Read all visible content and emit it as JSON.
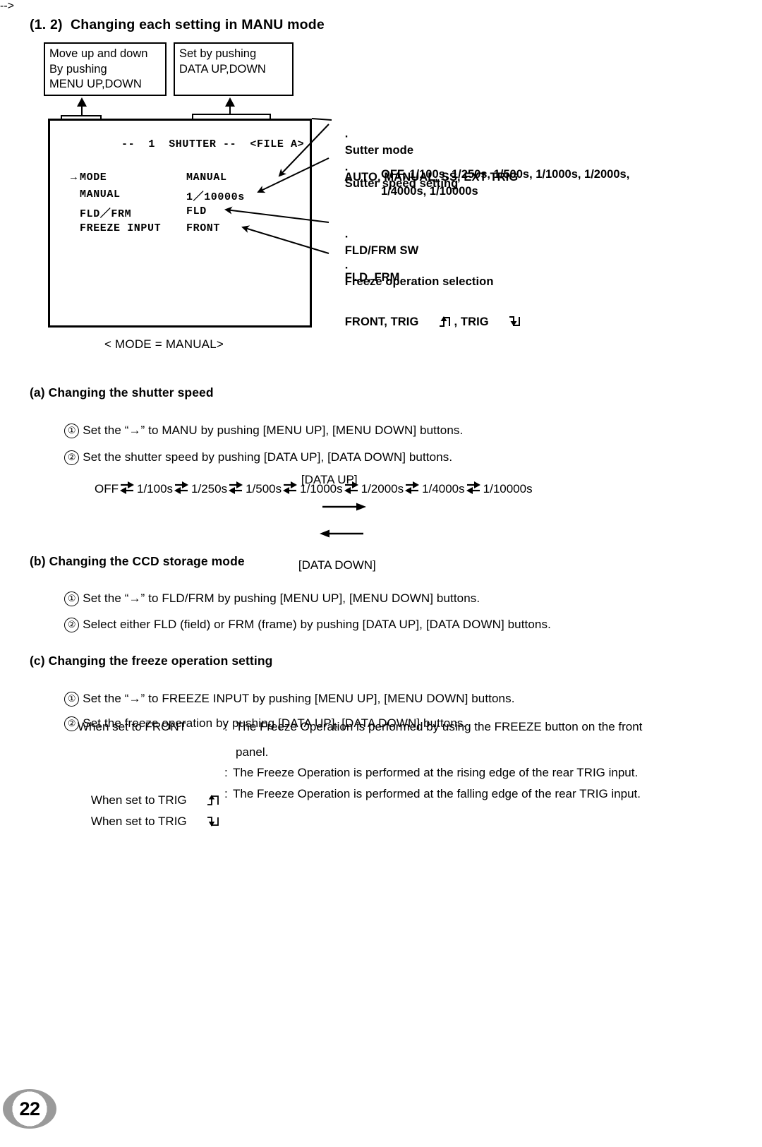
{
  "document": {
    "page_number": "22",
    "section_title": "(1. 2)  Changing each setting in MANU mode"
  },
  "diagram": {
    "callouts": [
      {
        "id": "menu",
        "text": "Move up and down\nBy pushing\nMENU UP,DOWN"
      },
      {
        "id": "data",
        "text": "Set by pushing\nDATA UP,DOWN"
      }
    ],
    "display": {
      "header": "--  1  SHUTTER --  <FILE A>",
      "rows": [
        {
          "pointer": "→",
          "label": "MODE",
          "value": "MANUAL"
        },
        {
          "pointer": " ",
          "label": "MANUAL",
          "value": "1／10000s"
        },
        {
          "pointer": " ",
          "label": "FLD／FRM",
          "value": "FLD"
        },
        {
          "pointer": " ",
          "label": "FREEZE INPUT",
          "value": "FRONT"
        }
      ],
      "caption": "< MODE = MANUAL>"
    },
    "annotations": [
      {
        "bullet": "·",
        "title": "Sutter mode",
        "values": "AUTO, MANUAL, SS, EXT TRIG"
      },
      {
        "bullet": "·",
        "title": "Sutter speed setting",
        "values": ""
      },
      {
        "bullet": "·",
        "title": "FLD/FRM SW",
        "values": "FLD, FRM"
      },
      {
        "bullet": "·",
        "title": "Freeze operation selection",
        "values": "FRONT, TRIG"
      }
    ],
    "speed_list_line1": "OFF, 1/100s, 1/250s, 1/500s, 1/1000s, 1/2000s,",
    "speed_list_line2": "1/4000s, 1/10000s",
    "freeze_values_tail": ", TRIG"
  },
  "section_a": {
    "heading": "(a) Changing the shutter speed",
    "steps": [
      {
        "num": "①",
        "text": "Set the “→” to MANU by pushing [MENU UP], [MENU DOWN] buttons."
      },
      {
        "num": "②",
        "text": "Set the shutter speed by pushing [DATA UP], [DATA DOWN] buttons."
      }
    ],
    "chain": {
      "up_label": "[DATA UP]",
      "down_label": "[DATA DOWN]",
      "items": [
        "OFF",
        "1/100s",
        "1/250s",
        "1/500s",
        "1/1000s",
        "1/2000s",
        "1/4000s",
        "1/10000s"
      ]
    }
  },
  "section_b": {
    "heading": "(b) Changing the CCD storage mode",
    "steps": [
      {
        "num": "①",
        "text": "Set the “→” to FLD/FRM by pushing [MENU UP], [MENU DOWN] buttons."
      },
      {
        "num": "②",
        "text": "Select either FLD (field) or FRM (frame) by pushing [DATA UP], [DATA DOWN] buttons."
      }
    ]
  },
  "section_c": {
    "heading": "(c) Changing the freeze operation setting",
    "steps": [
      {
        "num": "①",
        "text": "Set the “→” to FREEZE INPUT by pushing [MENU UP], [MENU DOWN] buttons."
      },
      {
        "num": "②",
        "text": "Set the freeze operation by pushing [DATA UP], [DATA DOWN] buttons."
      }
    ],
    "cases": [
      {
        "label": "When set to FRONT",
        "colon": ":",
        "desc_line1": "The Freeze Operation is performed by using the FREEZE button on the front",
        "desc_line2": "panel."
      },
      {
        "label": "When set to TRIG",
        "symbol": "rising-edge",
        "colon": ":",
        "desc_line1": "The Freeze Operation is performed at the rising edge of the rear TRIG input.",
        "desc_line2": ""
      },
      {
        "label": "When set to TRIG",
        "symbol": "falling-edge",
        "colon": ":",
        "desc_line1": "The Freeze Operation is performed at the falling edge of the rear TRIG input.",
        "desc_line2": ""
      }
    ]
  }
}
